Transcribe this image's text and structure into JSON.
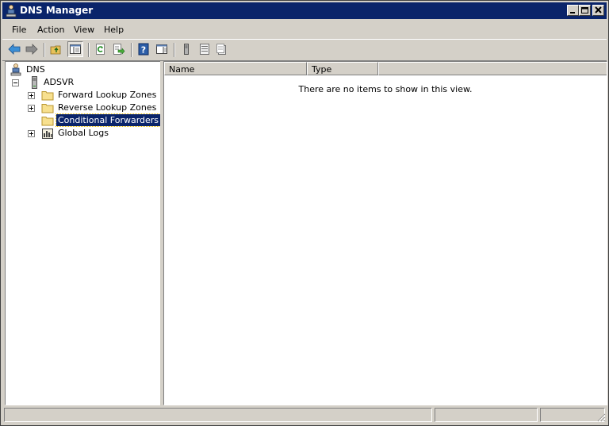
{
  "window": {
    "title": "DNS Manager"
  },
  "menu": {
    "items": [
      "File",
      "Action",
      "View",
      "Help"
    ]
  },
  "toolbar": {
    "buttons": [
      "back-icon",
      "forward-icon",
      "up-folder-icon",
      "show-hide-tree-icon",
      "refresh-icon",
      "export-list-icon",
      "help-icon",
      "show-hide-action-pane-icon",
      "server-icon",
      "list-view-icon",
      "properties-icon"
    ]
  },
  "tree": {
    "root": "DNS",
    "server": "ADSVR",
    "items": [
      "Forward Lookup Zones",
      "Reverse Lookup Zones",
      "Conditional Forwarders",
      "Global Logs"
    ],
    "selected": "Conditional Forwarders"
  },
  "list": {
    "columns": [
      "Name",
      "Type"
    ],
    "empty_message": "There are no items to show in this view."
  },
  "status": {
    "cells": [
      "",
      "",
      ""
    ]
  }
}
